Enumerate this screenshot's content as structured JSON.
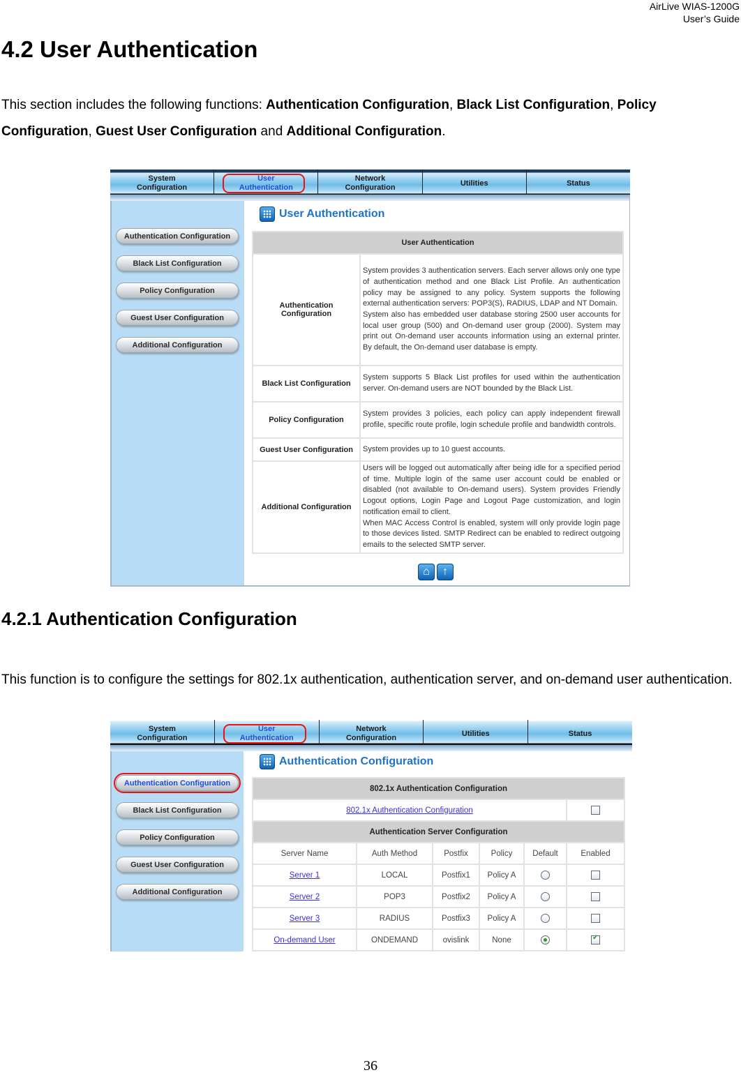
{
  "header": {
    "product": "AirLive  WIAS-1200G",
    "guide": "User’s  Guide"
  },
  "section": {
    "title": "4.2 User Authentication",
    "intro_prefix": "This section includes the following functions: ",
    "functions": [
      "Authentication Configuration",
      "Black List Configuration",
      "Policy Configuration",
      "Guest User Configuration",
      "Additional Configuration"
    ],
    "sep_comma": ", ",
    "sep_and": " and ",
    "end": "."
  },
  "subsection": {
    "title": "4.2.1 Authentication Configuration",
    "text": "This function is to configure the settings for 802.1x authentication, authentication server, and on-demand user authentication."
  },
  "nav": {
    "items": [
      {
        "line1": "System",
        "line2": "Configuration"
      },
      {
        "line1": "User",
        "line2": "Authentication"
      },
      {
        "line1": "Network",
        "line2": "Configuration"
      },
      {
        "line1": "Utilities",
        "line2": ""
      },
      {
        "line1": "Status",
        "line2": ""
      }
    ],
    "active_index": 1
  },
  "sidebar": {
    "items": [
      "Authentication Configuration",
      "Black List Configuration",
      "Policy Configuration",
      "Guest User Configuration",
      "Additional Configuration"
    ]
  },
  "screen1": {
    "page_title": "User Authentication",
    "table_header": "User Authentication",
    "rows": [
      {
        "label": "Authentication Configuration",
        "desc": "System provides 3 authentication servers. Each server allows only one type of authentication method and one Black List Profile. An authentication policy may be assigned to any policy. System supports the following external authentication servers: POP3(S), RADIUS, LDAP and NT Domain.",
        "desc2": "System also has embedded user database storing 2500 user accounts for local user group (500) and On-demand user group (2000). System may print out On-demand user accounts information using an external printer. By default, the On-demand user database is empty."
      },
      {
        "label": "Black List Configuration",
        "desc": "System supports 5 Black List profiles for used within the authentication server. On-demand users are NOT bounded by the Black List.",
        "desc2": ""
      },
      {
        "label": "Policy Configuration",
        "desc": "System provides 3 policies, each policy can apply independent firewall profile, specific route profile, login schedule profile and bandwidth controls.",
        "desc2": ""
      },
      {
        "label": "Guest User Configuration",
        "desc": "System provides up to 10 guest accounts.",
        "desc2": ""
      },
      {
        "label": "Additional Configuration",
        "desc": "Users will be logged out automatically after being idle for a specified period of time. Multiple login of the same user account could be enabled or disabled (not available to On-demand users). System provides Friendly Logout options, Login Page and Logout Page customization, and login notification email to client.",
        "desc2": "When MAC Access Control is enabled, system will only provide login page to those devices listed. SMTP Redirect can be enabled to redirect outgoing emails to the selected SMTP server."
      }
    ],
    "icons": [
      "home-icon",
      "up-arrow-icon"
    ]
  },
  "screen2": {
    "page_title": "Authentication Configuration",
    "dot1x_header": "802.1x Authentication Configuration",
    "dot1x_link": "802.1x Authentication Configuration",
    "dot1x_enabled": false,
    "server_header": "Authentication Server Configuration",
    "columns": [
      "Server Name",
      "Auth Method",
      "Postfix",
      "Policy",
      "Default",
      "Enabled"
    ],
    "servers": [
      {
        "name": "Server 1",
        "method": "LOCAL",
        "postfix": "Postfix1",
        "policy": "Policy A",
        "default": false,
        "enabled": false
      },
      {
        "name": "Server 2",
        "method": "POP3",
        "postfix": "Postfix2",
        "policy": "Policy A",
        "default": false,
        "enabled": false
      },
      {
        "name": "Server 3",
        "method": "RADIUS",
        "postfix": "Postfix3",
        "policy": "Policy A",
        "default": false,
        "enabled": false
      },
      {
        "name": "On-demand User",
        "method": "ONDEMAND",
        "postfix": "ovislink",
        "policy": "None",
        "default": true,
        "enabled": true
      }
    ]
  },
  "footer": {
    "page_number": "36"
  }
}
